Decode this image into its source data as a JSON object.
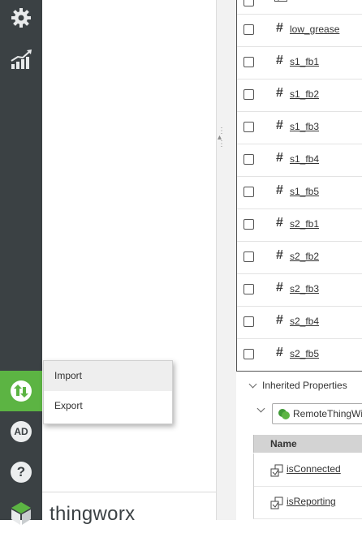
{
  "sidebar": {
    "icons": [
      "gear-icon",
      "chart-bars-icon",
      "import-export-icon",
      "user-avatar-icon",
      "help-icon",
      "thingworx-logo-icon"
    ],
    "avatar_initials": "AD",
    "help_glyph": "?",
    "active_color": "#5cb443",
    "bg_color": "#3b4144"
  },
  "brand": {
    "name": "thingworx"
  },
  "popup_menu": {
    "items": [
      "Import",
      "Export"
    ]
  },
  "properties": {
    "rows": [
      "low_grease",
      "s1_fb1",
      "s1_fb2",
      "s1_fb3",
      "s1_fb4",
      "s1_fb5",
      "s2_fb1",
      "s2_fb2",
      "s2_fb3",
      "s2_fb4",
      "s2_fb5"
    ],
    "type_glyph": "#"
  },
  "inherited": {
    "header": "Inherited Properties",
    "source": "RemoteThingWi",
    "column_name": "Name",
    "rows": [
      "isConnected",
      "isReporting"
    ]
  }
}
